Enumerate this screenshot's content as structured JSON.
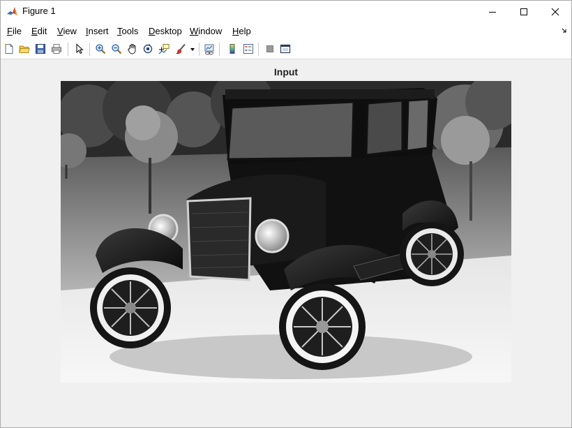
{
  "window": {
    "title": "Figure 1",
    "controls": [
      "minimize-icon",
      "maximize-icon",
      "close-icon"
    ]
  },
  "menubar": {
    "items": [
      {
        "label": "File"
      },
      {
        "label": "Edit"
      },
      {
        "label": "View"
      },
      {
        "label": "Insert"
      },
      {
        "label": "Tools"
      },
      {
        "label": "Desktop"
      },
      {
        "label": "Window"
      },
      {
        "label": "Help"
      }
    ]
  },
  "toolbar": {
    "buttons": [
      "new-figure-icon",
      "open-file-icon",
      "save-figure-icon",
      "print-figure-icon",
      "edit-plot-arrow-icon",
      "zoom-in-icon",
      "zoom-out-icon",
      "pan-hand-icon",
      "rotate-3d-icon",
      "data-cursor-icon",
      "brush-icon",
      "link-plot-icon",
      "insert-colorbar-icon",
      "insert-legend-icon",
      "hide-plot-tools-icon",
      "show-plot-tools-icon"
    ]
  },
  "axes": {
    "title": "Input",
    "image_description_icon": "grayscale-photo-vintage-car"
  },
  "colors": {
    "figure_background": "#f0f0f0",
    "titlebar": "#ffffff",
    "accent": "#0072bd"
  }
}
